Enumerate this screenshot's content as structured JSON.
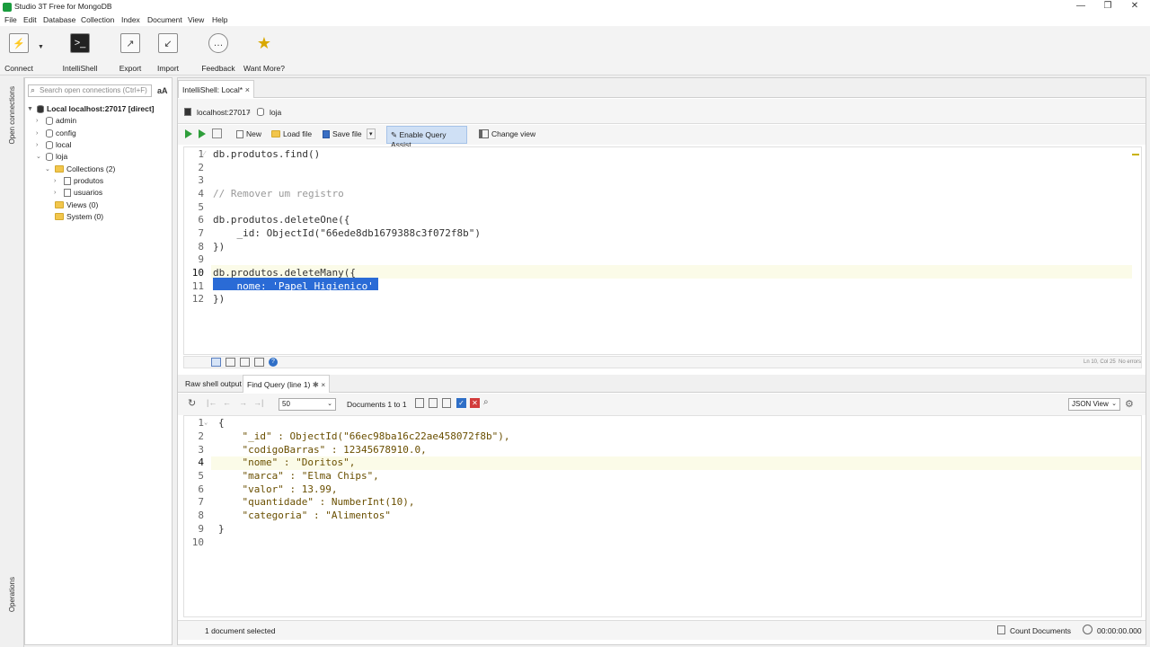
{
  "window": {
    "title": "Studio 3T Free for MongoDB",
    "controls": [
      "minimize",
      "restore",
      "close"
    ]
  },
  "menu": [
    "File",
    "Edit",
    "Database",
    "Collection",
    "Index",
    "Document",
    "View",
    "Help"
  ],
  "toolbar": {
    "connect": "Connect",
    "intellishell": "IntelliShell",
    "export": "Export",
    "import": "Import",
    "feedback": "Feedback",
    "want_more": "Want More?"
  },
  "left_rail": {
    "open_connections": "Open connections",
    "operations": "Operations"
  },
  "sidebar": {
    "search_placeholder": "Search open connections (Ctrl+F)",
    "font_toggle": "aA",
    "connection": "Local localhost:27017 [direct]",
    "databases": [
      "admin",
      "config",
      "local",
      "loja"
    ],
    "collections_folder": "Collections (2)",
    "collections": [
      "produtos",
      "usuarios"
    ],
    "views": "Views (0)",
    "system": "System (0)"
  },
  "tab": {
    "label": "IntelliShell: Local*",
    "close": "×"
  },
  "breadcrumb": {
    "server": "localhost:27017",
    "database": "loja"
  },
  "editor_toolbar": {
    "new": "New",
    "load_file": "Load file",
    "save_file": "Save file",
    "query_assist": "Enable Query Assist",
    "change_view": "Change view"
  },
  "editor": {
    "lines": [
      {
        "n": "1",
        "text": "db.produtos.find()"
      },
      {
        "n": "2",
        "text": ""
      },
      {
        "n": "3",
        "text": ""
      },
      {
        "n": "4",
        "text": "// Remover um registro"
      },
      {
        "n": "5",
        "text": ""
      },
      {
        "n": "6",
        "text": "db.produtos.deleteOne({"
      },
      {
        "n": "7",
        "text": "    _id: ObjectId(\"66ede8db1679388c3f072f8b\")"
      },
      {
        "n": "8",
        "text": "})"
      },
      {
        "n": "9",
        "text": ""
      },
      {
        "n": "10",
        "text": "db.produtos.deleteMany({"
      },
      {
        "n": "11",
        "text": "    nome: 'Papel Higienico'"
      },
      {
        "n": "12",
        "text": "})"
      }
    ],
    "status": "Ln 10, Col 25",
    "error_status": "No errors"
  },
  "result_tabs": {
    "raw": "Raw shell output",
    "find": "Find Query (line 1)"
  },
  "result_toolbar": {
    "page_size": "50",
    "documents": "Documents 1 to 1",
    "view_mode": "JSON View"
  },
  "result": {
    "lines": [
      {
        "n": "1",
        "text": "{"
      },
      {
        "n": "2",
        "text": "    \"_id\" : ObjectId(\"66ec98ba16c22ae458072f8b\"),"
      },
      {
        "n": "3",
        "text": "    \"codigoBarras\" : 12345678910.0,"
      },
      {
        "n": "4",
        "text": "    \"nome\" : \"Doritos\","
      },
      {
        "n": "5",
        "text": "    \"marca\" : \"Elma Chips\","
      },
      {
        "n": "6",
        "text": "    \"valor\" : 13.99,"
      },
      {
        "n": "7",
        "text": "    \"quantidade\" : NumberInt(10),"
      },
      {
        "n": "8",
        "text": "    \"categoria\" : \"Alimentos\""
      },
      {
        "n": "9",
        "text": "}"
      },
      {
        "n": "10",
        "text": ""
      }
    ]
  },
  "statusbar": {
    "selected": "1 document selected",
    "count_docs": "Count Documents",
    "time": "00:00:00.000"
  }
}
